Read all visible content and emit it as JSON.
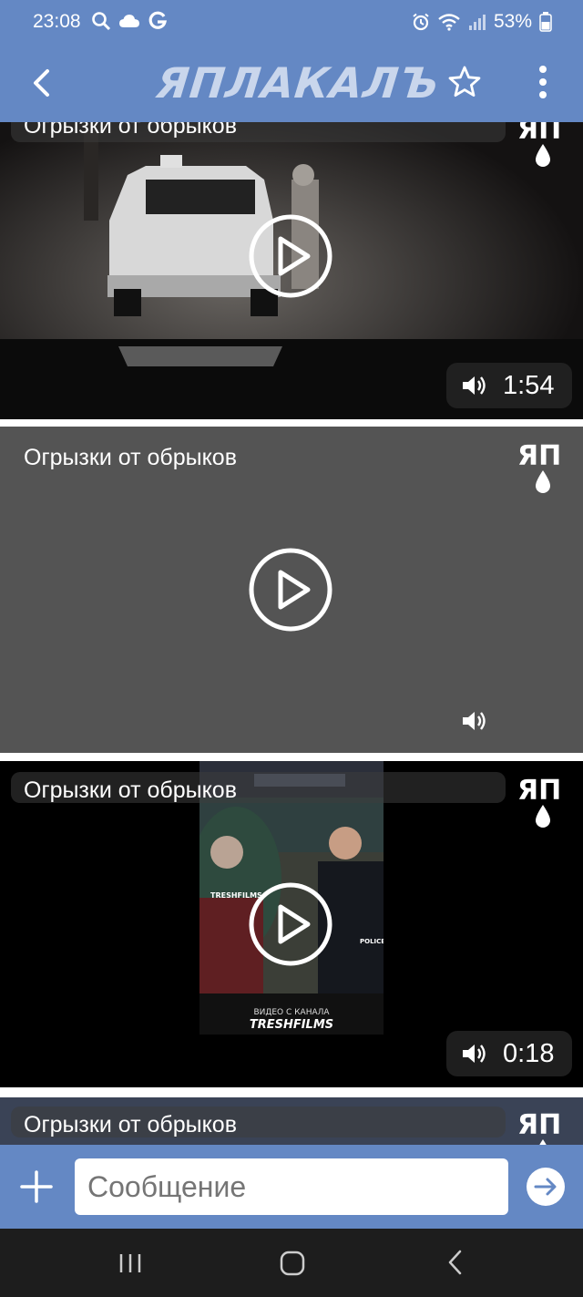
{
  "status": {
    "time": "23:08",
    "battery": "53%"
  },
  "app": {
    "logo": "ЯПЛАКАЛЪ"
  },
  "feed": {
    "items": [
      {
        "title": "Огрызки от обрыков",
        "duration": "1:54",
        "badge": "ЯП"
      },
      {
        "title": "Огрызки от обрыков",
        "duration": "",
        "badge": "ЯП"
      },
      {
        "title": "Огрызки от обрыков",
        "duration": "0:18",
        "badge": "ЯП",
        "thumb_text": "TRESHFILMS",
        "thumb_small": "ВИДЕО С КАНАЛА",
        "thumb_badge": "POLICE"
      },
      {
        "title": "Огрызки от обрыков",
        "badge": "ЯП"
      }
    ]
  },
  "composer": {
    "placeholder": "Сообщение"
  },
  "colors": {
    "header": "#6488c4",
    "card_grey": "#545454",
    "navbar": "#1d1d1d"
  }
}
